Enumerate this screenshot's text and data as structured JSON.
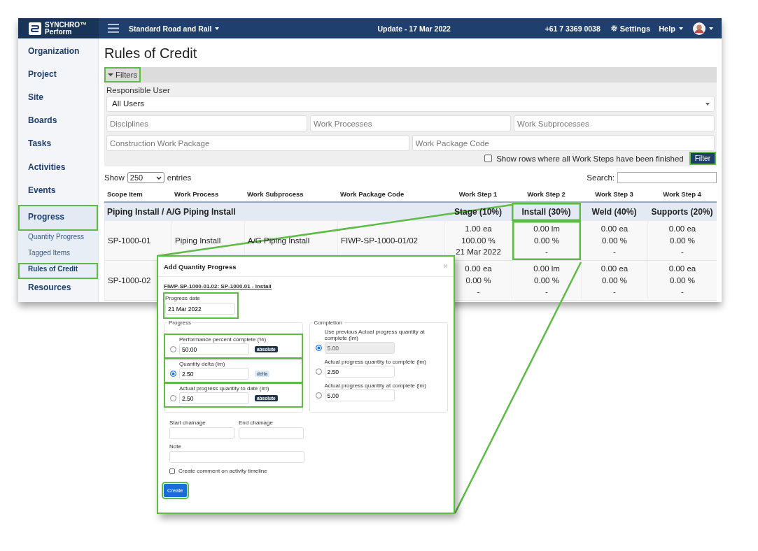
{
  "topbar": {
    "logo_name": "SYNCHRO™",
    "logo_product": "Perform",
    "project": "Standard Road and Rail",
    "update": "Update - 17 Mar 2022",
    "phone": "+61 7 3369 0038",
    "settings": "Settings",
    "help": "Help"
  },
  "sidebar": {
    "items": [
      {
        "label": "Organization",
        "kind": "main",
        "selected": false,
        "highlighted": false
      },
      {
        "label": "Project",
        "kind": "main",
        "selected": false,
        "highlighted": false
      },
      {
        "label": "Site",
        "kind": "main",
        "selected": false,
        "highlighted": false
      },
      {
        "label": "Boards",
        "kind": "main",
        "selected": false,
        "highlighted": false
      },
      {
        "label": "Tasks",
        "kind": "main",
        "selected": false,
        "highlighted": false
      },
      {
        "label": "Activities",
        "kind": "main",
        "selected": false,
        "highlighted": false
      },
      {
        "label": "Events",
        "kind": "main",
        "selected": false,
        "highlighted": false
      },
      {
        "label": "Progress",
        "kind": "main",
        "selected": true,
        "highlighted": true
      },
      {
        "label": "Quantity Progress",
        "kind": "sub",
        "selected": false,
        "highlighted": false
      },
      {
        "label": "Tagged Items",
        "kind": "sub",
        "selected": false,
        "highlighted": false
      },
      {
        "label": "Rules of Credit",
        "kind": "sub",
        "selected": true,
        "highlighted": true
      },
      {
        "label": "Resources",
        "kind": "main",
        "selected": false,
        "highlighted": false
      }
    ]
  },
  "page": {
    "title": "Rules of Credit"
  },
  "filters": {
    "toggle": {
      "label": "Filters",
      "expanded": true,
      "highlighted": true
    },
    "responsible_label": "Responsible User",
    "responsible_value": "All Users",
    "fields_row1": [
      {
        "placeholder": "Disciplines"
      },
      {
        "placeholder": "Work Processes"
      },
      {
        "placeholder": "Work Subprocesses"
      }
    ],
    "fields_row2": [
      {
        "placeholder": "Construction Work Package"
      },
      {
        "placeholder": "Work Package Code"
      }
    ],
    "show_finished": {
      "label": "Show rows where all Work Steps have been finished",
      "checked": false
    },
    "filter_button": {
      "label": "Filter",
      "highlighted": true
    }
  },
  "table": {
    "show_label": "Show",
    "entries_value": "250",
    "entries_label": "entries",
    "search_label": "Search:",
    "columns": [
      "Scope Item",
      "Work Process",
      "Work Subprocess",
      "Work Package Code",
      "Work Step 1",
      "Work Step 2",
      "Work Step 3",
      "Work Step 4"
    ],
    "group": {
      "label": "Piping Install / A/G Piping Install",
      "steps": [
        {
          "label": "Stage (10%)",
          "highlighted": false
        },
        {
          "label": "Install (30%)",
          "highlighted": true
        },
        {
          "label": "Weld (40%)",
          "highlighted": false
        },
        {
          "label": "Supports (20%)",
          "highlighted": false
        }
      ]
    },
    "rows": [
      {
        "scope": "SP-1000-01",
        "process": "Piping Install",
        "subprocess": "A/G Piping Install",
        "package": "FIWP-SP-1000-01/02",
        "steps": [
          {
            "lines": [
              "1.00 ea",
              "100.00 %",
              "21 Mar 2022"
            ],
            "highlighted": false
          },
          {
            "lines": [
              "0.00 lm",
              "0.00 %",
              "-"
            ],
            "highlighted": true
          },
          {
            "lines": [
              "0.00 ea",
              "0.00 %",
              "-"
            ],
            "highlighted": false
          },
          {
            "lines": [
              "0.00 ea",
              "0.00 %",
              "-"
            ],
            "highlighted": false
          }
        ]
      },
      {
        "scope": "SP-1000-02",
        "steps": [
          {
            "lines": [
              "0.00 ea",
              "0.00 %",
              "-"
            ],
            "highlighted": false
          },
          {
            "lines": [
              "0.00 lm",
              "0.00 %",
              "-"
            ],
            "highlighted": false
          },
          {
            "lines": [
              "0.00 ea",
              "0.00 %",
              "-"
            ],
            "highlighted": false
          },
          {
            "lines": [
              "0.00 ea",
              "0.00 %",
              "-"
            ],
            "highlighted": false
          }
        ]
      }
    ]
  },
  "modal": {
    "title": "Add Quantity Progress",
    "close": "×",
    "link": "FIWP-SP-1000-01.02: SP-1000.01 - Install",
    "date": {
      "label": "Progress date",
      "value": "21 Mar 2022",
      "highlighted": true
    },
    "progress": {
      "legend": "Progress",
      "options": [
        {
          "label": "Performance percent complete (%)",
          "value": "50.00",
          "badge": "absolute",
          "kind": "dark",
          "selected": false,
          "highlighted": true
        },
        {
          "label": "Quantity delta (lm)",
          "value": "2.50",
          "badge": "delta",
          "kind": "light",
          "selected": true,
          "highlighted": true
        },
        {
          "label": "Actual progress quantity to date (lm)",
          "value": "2.50",
          "badge": "absolute",
          "kind": "dark",
          "selected": false,
          "highlighted": true
        }
      ]
    },
    "completion": {
      "legend": "Completion",
      "options": [
        {
          "label": "Use previous Actual progress quantity at complete (lm)",
          "value": "5.00",
          "disabled": true,
          "selected": true
        },
        {
          "label": "Actual progress quantity to complete (lm)",
          "value": "2.50",
          "disabled": false,
          "selected": false
        },
        {
          "label": "Actual progress quantity at complete (lm)",
          "value": "5.00",
          "disabled": false,
          "selected": false
        }
      ]
    },
    "start_label": "Start chainage",
    "end_label": "End chainage",
    "note_label": "Note",
    "comment": {
      "label": "Create comment on activity timeline",
      "checked": false
    },
    "create": {
      "label": "Create",
      "highlighted": true
    }
  }
}
